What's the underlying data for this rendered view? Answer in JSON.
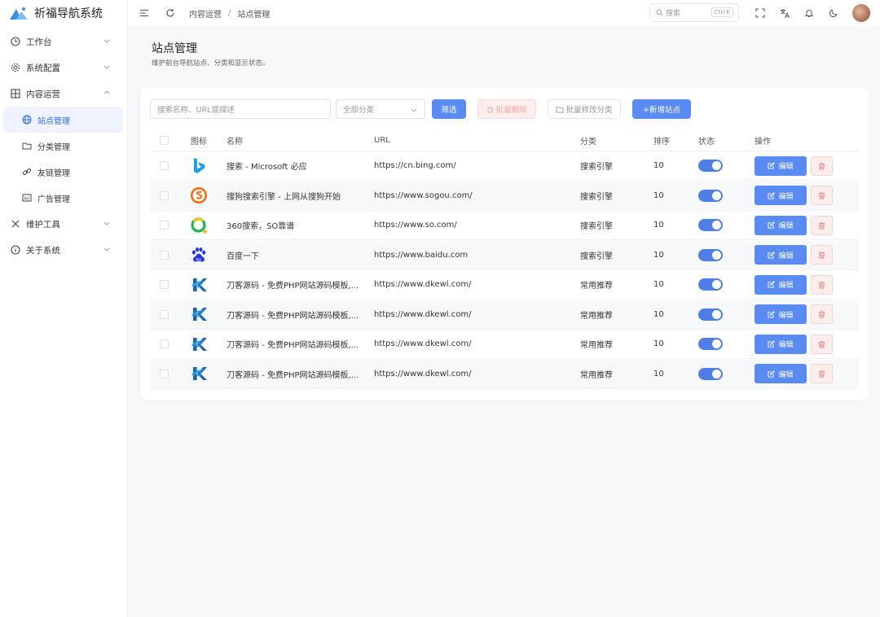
{
  "app": {
    "title": "祈福导航系统"
  },
  "sidebar": {
    "items": [
      {
        "label": "工作台",
        "icon": "clock-icon"
      },
      {
        "label": "系统配置",
        "icon": "gear-icon"
      },
      {
        "label": "内容运营",
        "icon": "grid-icon"
      },
      {
        "label": "维护工具",
        "icon": "tools-icon"
      },
      {
        "label": "关于系统",
        "icon": "info-icon"
      }
    ],
    "sub_items": [
      {
        "label": "站点管理",
        "icon": "globe-icon"
      },
      {
        "label": "分类管理",
        "icon": "folder-icon"
      },
      {
        "label": "友链管理",
        "icon": "link-icon"
      },
      {
        "label": "广告管理",
        "icon": "ad-icon"
      }
    ]
  },
  "header": {
    "breadcrumb": [
      "内容运营",
      "站点管理"
    ],
    "breadcrumb_sep": "/",
    "search_placeholder": "搜索",
    "search_kbd": "Ctrl K"
  },
  "page": {
    "title": "站点管理",
    "description": "维护前台导航站点、分类和显示状态。"
  },
  "toolbar": {
    "search_placeholder": "搜索名称、URL或描述",
    "category_select": "全部分类",
    "filter_label": "筛选",
    "batch_delete_label": "批量删除",
    "batch_category_label": "批量修改分类",
    "add_label": "+新增站点"
  },
  "table": {
    "headers": [
      "图标",
      "名称",
      "URL",
      "分类",
      "排序",
      "状态",
      "操作"
    ],
    "edit_label": "编辑",
    "rows": [
      {
        "icon": "bing-logo-icon",
        "name": "搜索 - Microsoft 必应",
        "url": "https://cn.bing.com/",
        "category": "搜索引擎",
        "sort": "10",
        "status": true
      },
      {
        "icon": "sogou-logo-icon",
        "name": "搜狗搜索引擎 - 上网从搜狗开始",
        "url": "https://www.sogou.com/",
        "category": "搜索引擎",
        "sort": "10",
        "status": true
      },
      {
        "icon": "so360-logo-icon",
        "name": "360搜索，SO靠谱",
        "url": "https://www.so.com/",
        "category": "搜索引擎",
        "sort": "10",
        "status": true
      },
      {
        "icon": "baidu-logo-icon",
        "name": "百度一下",
        "url": "https://www.baidu.com",
        "category": "搜索引擎",
        "sort": "10",
        "status": true
      },
      {
        "icon": "dkewl-logo-icon",
        "name": "刀客源码 - 免费PHP网站源码模板,...",
        "url": "https://www.dkewl.com/",
        "category": "常用推荐",
        "sort": "10",
        "status": true
      },
      {
        "icon": "dkewl-logo-icon",
        "name": "刀客源码 - 免费PHP网站源码模板,...",
        "url": "https://www.dkewl.com/",
        "category": "常用推荐",
        "sort": "10",
        "status": true
      },
      {
        "icon": "dkewl-logo-icon",
        "name": "刀客源码 - 免费PHP网站源码模板,...",
        "url": "https://www.dkewl.com/",
        "category": "常用推荐",
        "sort": "10",
        "status": true
      },
      {
        "icon": "dkewl-logo-icon",
        "name": "刀客源码 - 免费PHP网站源码模板,...",
        "url": "https://www.dkewl.com/",
        "category": "常用推荐",
        "sort": "10",
        "status": true
      }
    ]
  },
  "colors": {
    "accent": "#5a8bf2",
    "toggle_on": "#4f7fe6",
    "danger_bg": "#fdeeee",
    "danger": "#e07a7a"
  }
}
